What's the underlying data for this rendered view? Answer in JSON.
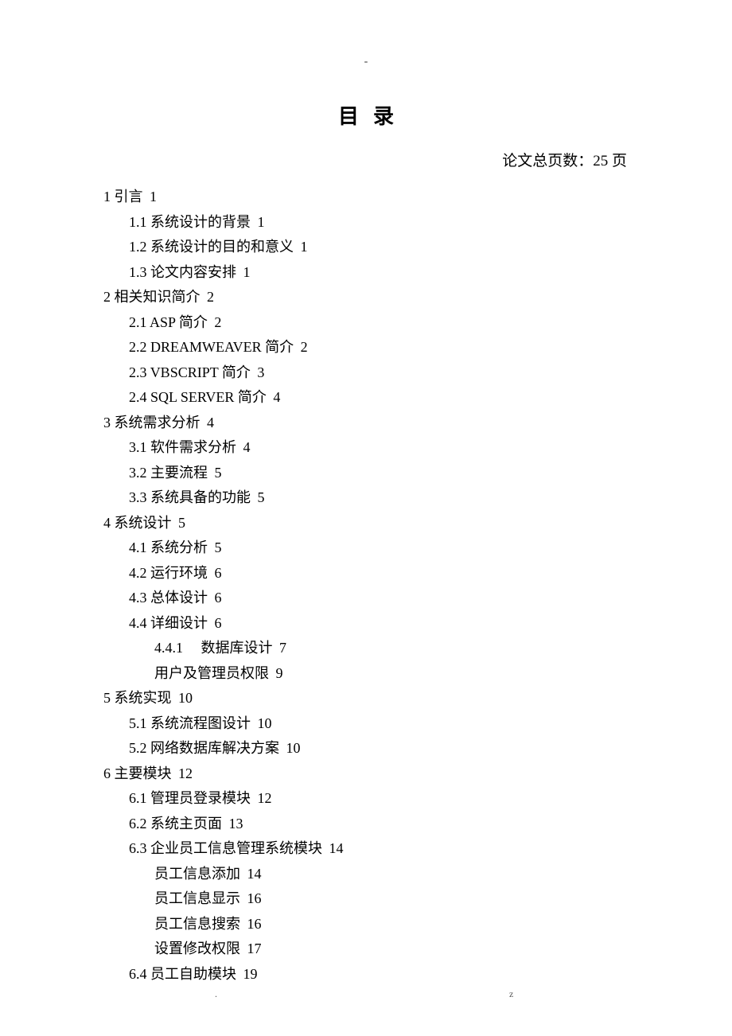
{
  "header": {
    "dash": "-",
    "title": "目录",
    "page_count": "论文总页数：25 页"
  },
  "toc": [
    {
      "lvl": 1,
      "num": "1",
      "text": "引言",
      "page": "1"
    },
    {
      "lvl": 2,
      "num": "1.1",
      "text": "系统设计的背景",
      "page": "1"
    },
    {
      "lvl": 2,
      "num": "1.2",
      "text": "系统设计的目的和意义",
      "page": "1"
    },
    {
      "lvl": 2,
      "num": "1.3",
      "text": "论文内容安排",
      "page": "1"
    },
    {
      "lvl": 1,
      "num": "2",
      "text": "相关知识简介",
      "page": "2"
    },
    {
      "lvl": 2,
      "num": "2.1",
      "text": "ASP 简介",
      "page": "2"
    },
    {
      "lvl": 2,
      "num": "2.2",
      "text": "DREAMWEAVER 简介",
      "page": "2"
    },
    {
      "lvl": 2,
      "num": "2.3",
      "text": "VBSCRIPT 简介",
      "page": "3"
    },
    {
      "lvl": 2,
      "num": "2.4",
      "text": "SQL SERVER 简介",
      "page": "4"
    },
    {
      "lvl": 1,
      "num": "3",
      "text": " 系统需求分析",
      "page": "4"
    },
    {
      "lvl": 2,
      "num": "3.1",
      "text": "软件需求分析",
      "page": "4"
    },
    {
      "lvl": 2,
      "num": "3.2",
      "text": "主要流程",
      "page": "5"
    },
    {
      "lvl": 2,
      "num": "3.3",
      "text": "系统具备的功能",
      "page": "5"
    },
    {
      "lvl": 1,
      "num": "4",
      "text": "系统设计",
      "page": "5"
    },
    {
      "lvl": 2,
      "num": "4.1",
      "text": "系统分析",
      "page": "5"
    },
    {
      "lvl": 2,
      "num": "4.2",
      "text": "运行环境",
      "page": "6"
    },
    {
      "lvl": 2,
      "num": "4.3",
      "text": "总体设计",
      "page": "6"
    },
    {
      "lvl": 2,
      "num": "4.4",
      "text": "详细设计",
      "page": "6"
    },
    {
      "lvl": 3,
      "num": "4.4.1",
      "text": "　数据库设计",
      "page": "7"
    },
    {
      "lvl": 3,
      "num": "",
      "text": "用户及管理员权限",
      "page": "9"
    },
    {
      "lvl": 1,
      "num": "5",
      "text": "系统实现",
      "page": "10"
    },
    {
      "lvl": 2,
      "num": "5.1",
      "text": "系统流程图设计",
      "page": "10"
    },
    {
      "lvl": 2,
      "num": "5.2",
      "text": "网络数据库解决方案",
      "page": "10"
    },
    {
      "lvl": 1,
      "num": "6",
      "text": "主要模块",
      "page": "12"
    },
    {
      "lvl": 2,
      "num": "6.1",
      "text": "管理员登录模块",
      "page": "12"
    },
    {
      "lvl": 2,
      "num": "6.2",
      "text": "系统主页面",
      "page": "13"
    },
    {
      "lvl": 2,
      "num": "6.3",
      "text": "企业员工信息管理系统模块",
      "page": "14"
    },
    {
      "lvl": 3,
      "num": "",
      "text": "员工信息添加",
      "page": "14"
    },
    {
      "lvl": 3,
      "num": "",
      "text": "员工信息显示",
      "page": "16"
    },
    {
      "lvl": 3,
      "num": "",
      "text": "员工信息搜索",
      "page": "16"
    },
    {
      "lvl": 3,
      "num": "",
      "text": "设置修改权限",
      "page": "17"
    },
    {
      "lvl": 2,
      "num": "6.4",
      "text": "员工自助模块",
      "page": "19"
    }
  ],
  "footer": {
    "left": ".",
    "right": "z"
  }
}
